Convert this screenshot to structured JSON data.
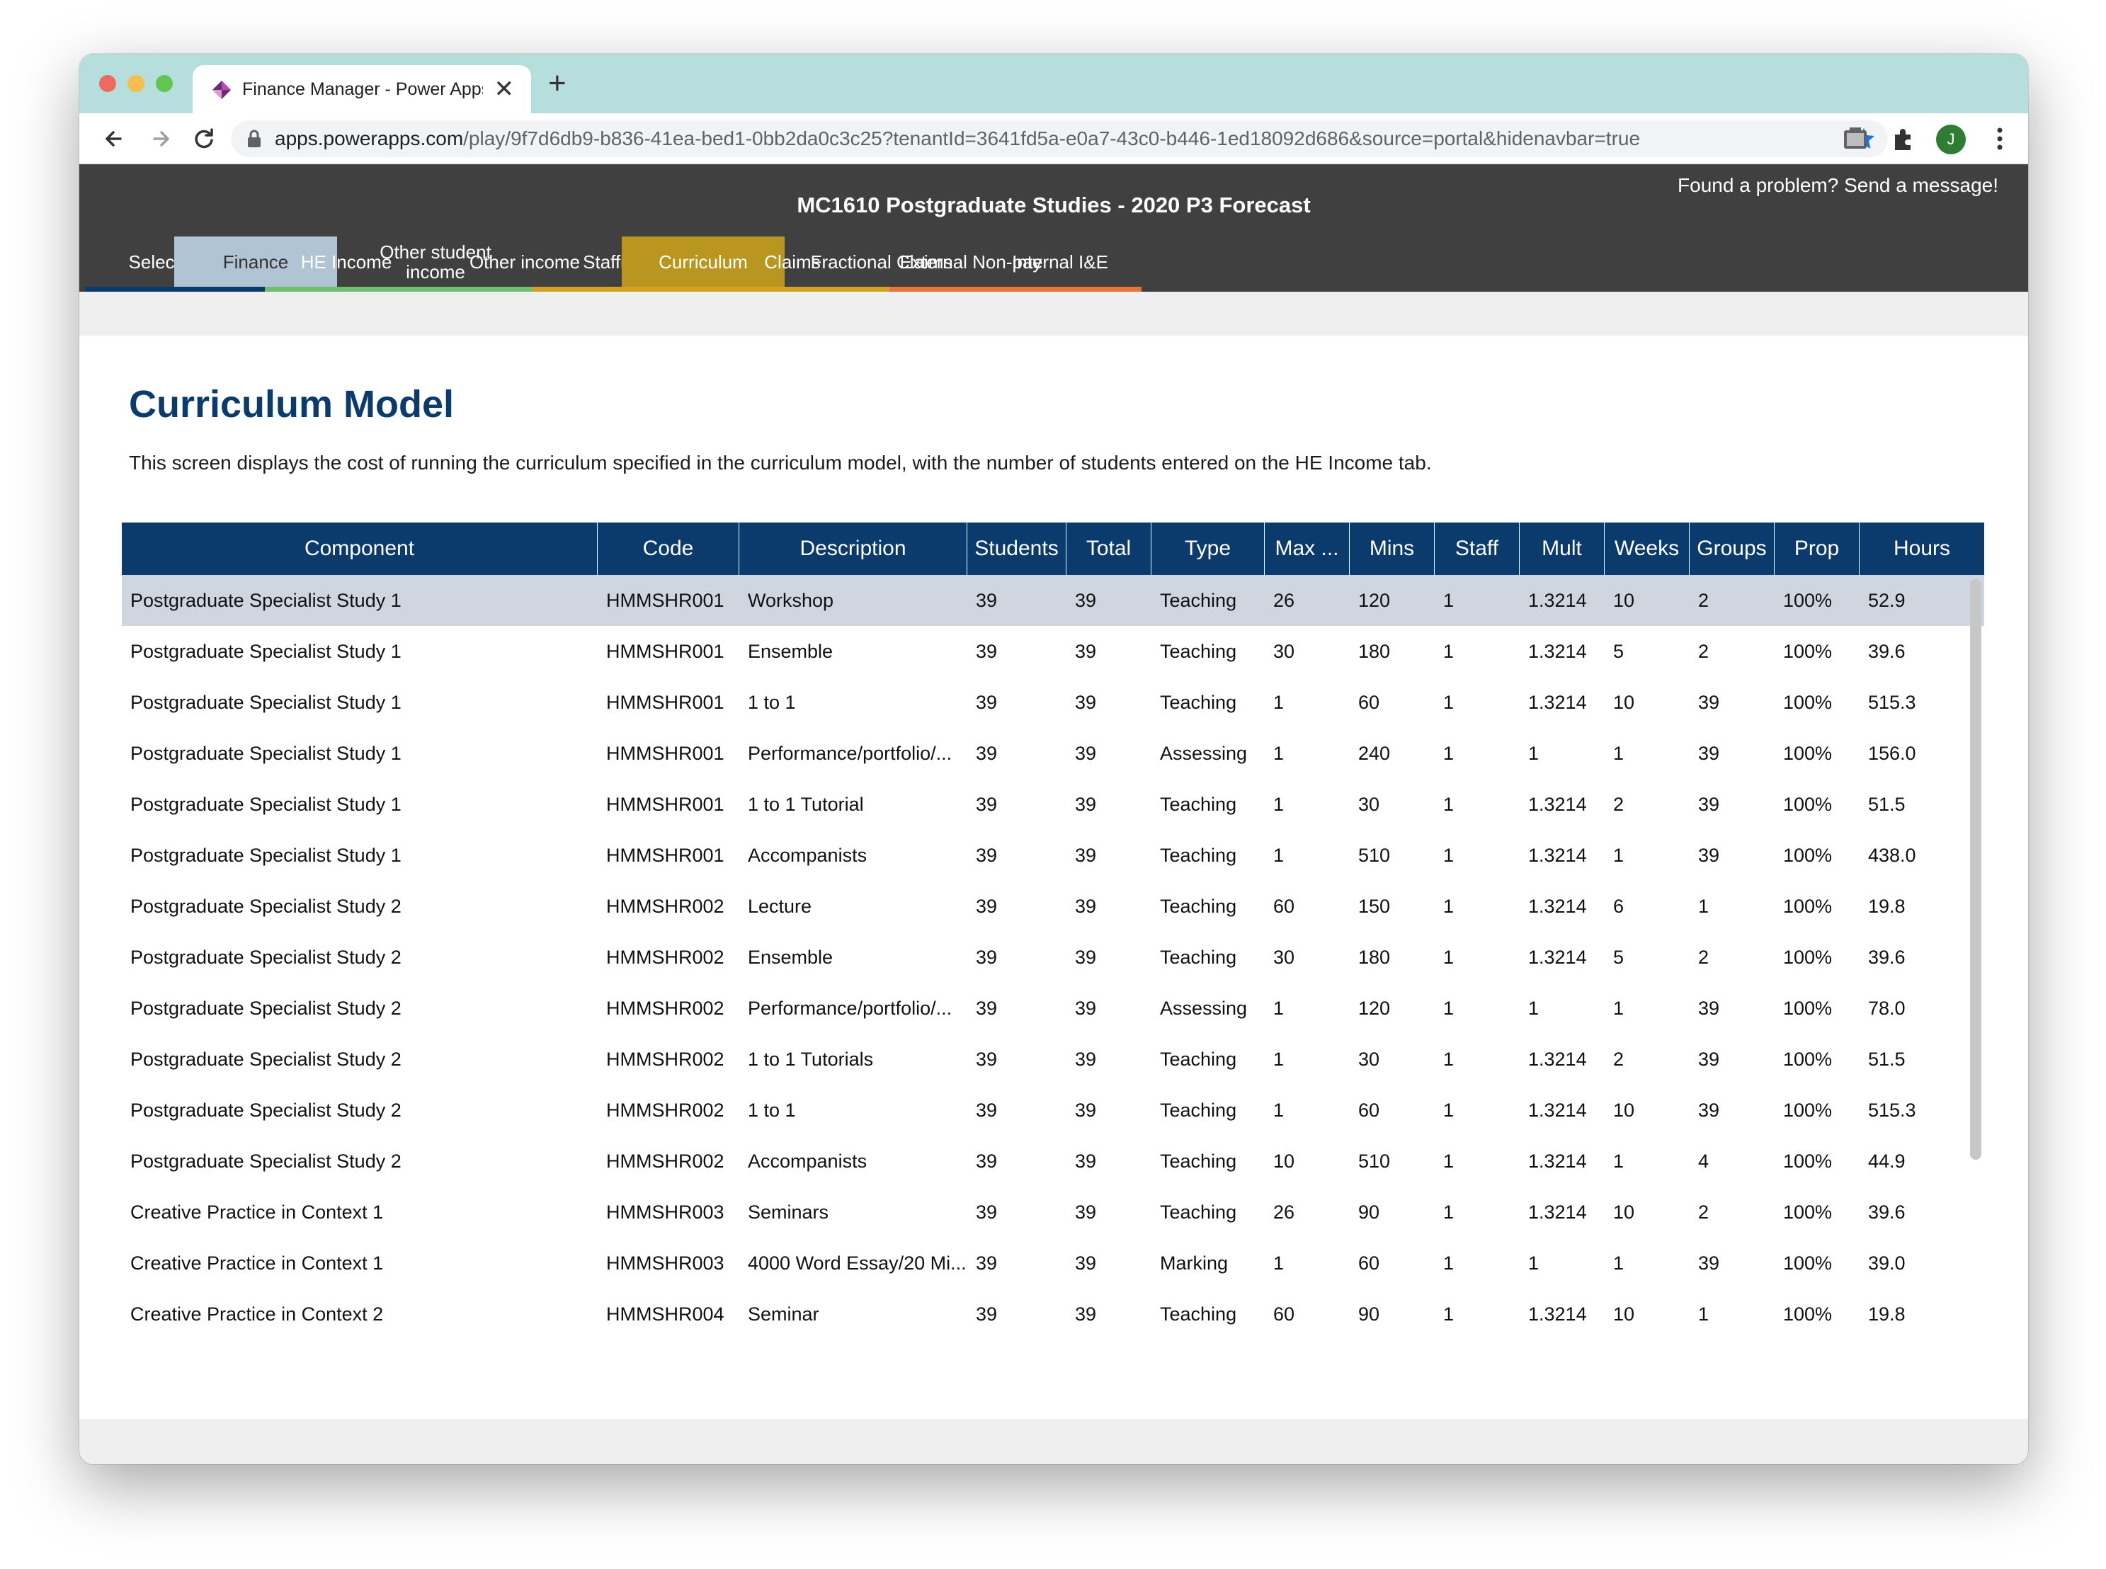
{
  "browser": {
    "tab_title": "Finance Manager - Power Apps",
    "tab_close": "✕",
    "new_tab": "+",
    "url_host": "apps.powerapps.com",
    "url_rest": "/play/9f7d6db9-b836-41ea-bed1-0bb2da0c3c25?tenantId=3641fd5a-e0a7-43c0-b446-1ed18092d686&source=portal&hidenavbar=true",
    "profile_initial": "J",
    "colors": {
      "tabstrip": "#b5dedd",
      "star": "#1a73e8",
      "profile": "#2e7d32"
    }
  },
  "header": {
    "title": "MC1610 Postgraduate Studies - 2020 P3 Forecast",
    "feedback": "Found a problem? Send a message!",
    "colors": {
      "background": "#404040"
    }
  },
  "nav_tabs": [
    {
      "label": "Selection",
      "underline": "#0b3a6c",
      "bg": ""
    },
    {
      "label": "Finance",
      "underline": "#0b3a6c",
      "bg": "#b0c4d4",
      "text": "#333333"
    },
    {
      "label": "HE Income",
      "underline": "#6fbf73",
      "bg": ""
    },
    {
      "label": "Other student income",
      "underline": "#6fbf73",
      "bg": ""
    },
    {
      "label": "Other income",
      "underline": "#6fbf73",
      "bg": ""
    },
    {
      "label": "Staffing",
      "underline": "#d4a21f",
      "bg": ""
    },
    {
      "label": "Curriculum",
      "underline": "#d4a21f",
      "bg": "#b8961f"
    },
    {
      "label": "Claims",
      "underline": "#d4a21f",
      "bg": ""
    },
    {
      "label": "Fractional Claims",
      "underline": "#d4a21f",
      "bg": ""
    },
    {
      "label": "External Non-pay",
      "underline": "#e8743b",
      "bg": ""
    },
    {
      "label": "Internal I&E",
      "underline": "#e8743b",
      "bg": ""
    }
  ],
  "page": {
    "heading": "Curriculum Model",
    "description": "This screen displays the cost of running the curriculum specified in the curriculum model, with the number of students entered on the HE Income tab."
  },
  "grid": {
    "columns": [
      "Component",
      "Code",
      "Description",
      "Students",
      "Total",
      "Type",
      "Max ...",
      "Mins",
      "Staff",
      "Mult",
      "Weeks",
      "Groups",
      "Prop",
      "Hours"
    ],
    "rows": [
      [
        "Postgraduate Specialist Study 1",
        "HMMSHR001",
        "Workshop",
        "39",
        "39",
        "Teaching",
        "26",
        "120",
        "1",
        "1.3214",
        "10",
        "2",
        "100%",
        "52.9"
      ],
      [
        "Postgraduate Specialist Study 1",
        "HMMSHR001",
        "Ensemble",
        "39",
        "39",
        "Teaching",
        "30",
        "180",
        "1",
        "1.3214",
        "5",
        "2",
        "100%",
        "39.6"
      ],
      [
        "Postgraduate Specialist Study 1",
        "HMMSHR001",
        "1 to 1",
        "39",
        "39",
        "Teaching",
        "1",
        "60",
        "1",
        "1.3214",
        "10",
        "39",
        "100%",
        "515.3"
      ],
      [
        "Postgraduate Specialist Study 1",
        "HMMSHR001",
        "Performance/portfolio/...",
        "39",
        "39",
        "Assessing",
        "1",
        "240",
        "1",
        "1",
        "1",
        "39",
        "100%",
        "156.0"
      ],
      [
        "Postgraduate Specialist Study 1",
        "HMMSHR001",
        "1 to 1 Tutorial",
        "39",
        "39",
        "Teaching",
        "1",
        "30",
        "1",
        "1.3214",
        "2",
        "39",
        "100%",
        "51.5"
      ],
      [
        "Postgraduate Specialist Study 1",
        "HMMSHR001",
        "Accompanists",
        "39",
        "39",
        "Teaching",
        "1",
        "510",
        "1",
        "1.3214",
        "1",
        "39",
        "100%",
        "438.0"
      ],
      [
        "Postgraduate Specialist Study 2",
        "HMMSHR002",
        "Lecture",
        "39",
        "39",
        "Teaching",
        "60",
        "150",
        "1",
        "1.3214",
        "6",
        "1",
        "100%",
        "19.8"
      ],
      [
        "Postgraduate Specialist Study 2",
        "HMMSHR002",
        "Ensemble",
        "39",
        "39",
        "Teaching",
        "30",
        "180",
        "1",
        "1.3214",
        "5",
        "2",
        "100%",
        "39.6"
      ],
      [
        "Postgraduate Specialist Study 2",
        "HMMSHR002",
        "Performance/portfolio/...",
        "39",
        "39",
        "Assessing",
        "1",
        "120",
        "1",
        "1",
        "1",
        "39",
        "100%",
        "78.0"
      ],
      [
        "Postgraduate Specialist Study 2",
        "HMMSHR002",
        "1 to 1 Tutorials",
        "39",
        "39",
        "Teaching",
        "1",
        "30",
        "1",
        "1.3214",
        "2",
        "39",
        "100%",
        "51.5"
      ],
      [
        "Postgraduate Specialist Study 2",
        "HMMSHR002",
        "1 to 1",
        "39",
        "39",
        "Teaching",
        "1",
        "60",
        "1",
        "1.3214",
        "10",
        "39",
        "100%",
        "515.3"
      ],
      [
        "Postgraduate Specialist Study 2",
        "HMMSHR002",
        "Accompanists",
        "39",
        "39",
        "Teaching",
        "10",
        "510",
        "1",
        "1.3214",
        "1",
        "4",
        "100%",
        "44.9"
      ],
      [
        "Creative Practice in Context 1",
        "HMMSHR003",
        "Seminars",
        "39",
        "39",
        "Teaching",
        "26",
        "90",
        "1",
        "1.3214",
        "10",
        "2",
        "100%",
        "39.6"
      ],
      [
        "Creative Practice in Context 1",
        "HMMSHR003",
        "4000 Word Essay/20 Mi...",
        "39",
        "39",
        "Marking",
        "1",
        "60",
        "1",
        "1",
        "1",
        "39",
        "100%",
        "39.0"
      ],
      [
        "Creative Practice in Context 2",
        "HMMSHR004",
        "Seminar",
        "39",
        "39",
        "Teaching",
        "60",
        "90",
        "1",
        "1.3214",
        "10",
        "1",
        "100%",
        "19.8"
      ]
    ],
    "selected_row": 0,
    "colors": {
      "header_bg": "#0b3a6c",
      "selected_bg": "#d0d6e0"
    }
  }
}
